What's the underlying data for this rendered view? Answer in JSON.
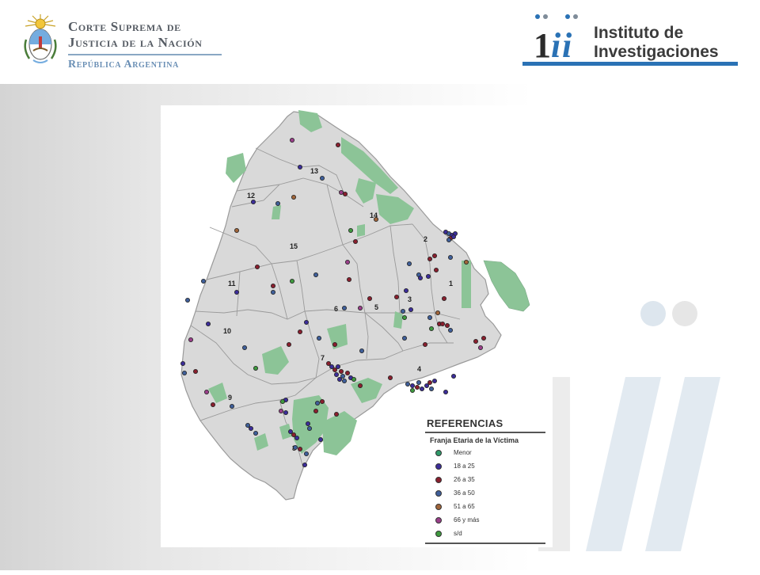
{
  "header": {
    "court": {
      "line1": "Corte Suprema de",
      "line2": "Justicia de la Nación",
      "line3": "República Argentina"
    },
    "institute": {
      "line1": "Instituto de",
      "line2": "Investigaciones"
    }
  },
  "map": {
    "commune_labels": [
      "1",
      "2",
      "3",
      "4",
      "5",
      "6",
      "7",
      "8",
      "9",
      "10",
      "11",
      "12",
      "13",
      "14",
      "15"
    ],
    "colors": {
      "land": "#d9d9d9",
      "park": "#8cc497",
      "border": "#9a9a9a"
    }
  },
  "legend": {
    "title": "REFERENCIAS",
    "subtitle": "Franja Etaria de la Víctima",
    "items": [
      {
        "label": "Menor",
        "color": "#2f9a6a"
      },
      {
        "label": "18 a 25",
        "color": "#3c2d9a"
      },
      {
        "label": "26 a 35",
        "color": "#8a1f2e"
      },
      {
        "label": "36 a 50",
        "color": "#3f5f9a"
      },
      {
        "label": "51 a 65",
        "color": "#a0653a"
      },
      {
        "label": "66 y más",
        "color": "#9a3f8a"
      },
      {
        "label": "s/d",
        "color": "#3f9a3f"
      }
    ]
  }
}
